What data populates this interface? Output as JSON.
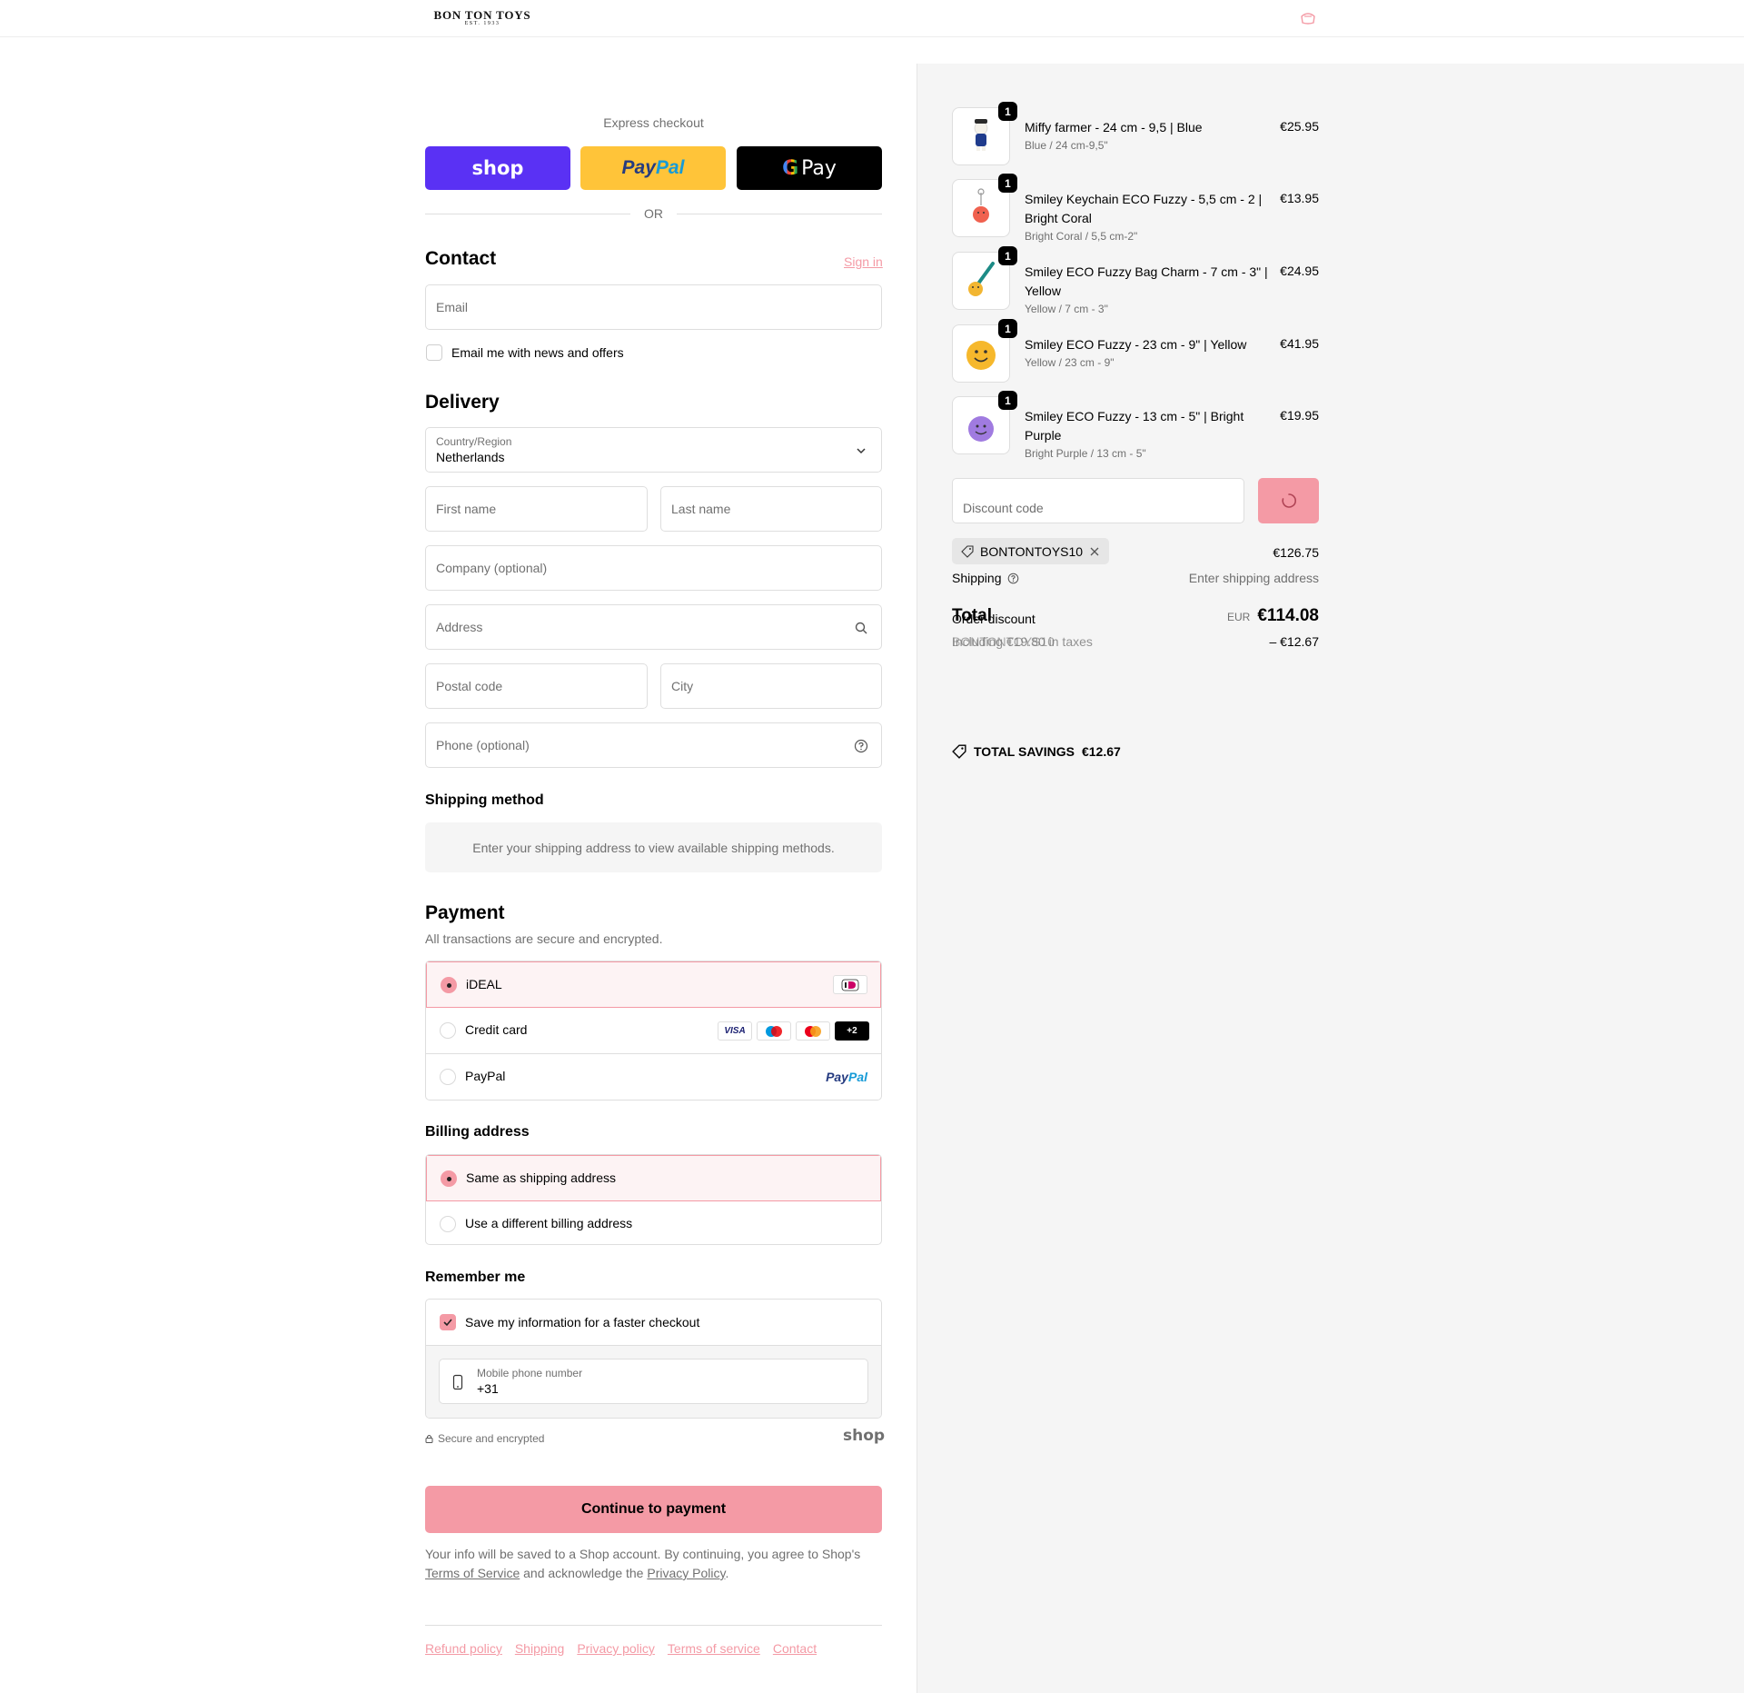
{
  "header": {
    "logo_main": "BON TON TOYS",
    "logo_sub": "EST. 1933"
  },
  "express": {
    "label": "Express checkout",
    "shop": "shop",
    "paypal_1": "Pay",
    "paypal_2": "Pal",
    "gpay_g": "G",
    "gpay": "Pay",
    "or": "OR"
  },
  "contact": {
    "title": "Contact",
    "sign_in": "Sign in",
    "email_placeholder": "Email",
    "newsletter": "Email me with news and offers"
  },
  "delivery": {
    "title": "Delivery",
    "country_label": "Country/Region",
    "country_value": "Netherlands",
    "first_name": "First name",
    "last_name": "Last name",
    "company": "Company (optional)",
    "address": "Address",
    "postal": "Postal code",
    "city": "City",
    "phone": "Phone (optional)"
  },
  "shipping_method": {
    "title": "Shipping method",
    "info": "Enter your shipping address to view available shipping methods."
  },
  "payment": {
    "title": "Payment",
    "subtitle": "All transactions are secure and encrypted.",
    "options": [
      "iDEAL",
      "Credit card",
      "PayPal"
    ],
    "selected": "iDEAL",
    "cards": {
      "visa": "VISA",
      "more": "+2"
    },
    "paypal_1": "Pay",
    "paypal_2": "Pal"
  },
  "billing": {
    "title": "Billing address",
    "options": [
      "Same as shipping address",
      "Use a different billing address"
    ],
    "selected": "Same as shipping address"
  },
  "remember": {
    "title": "Remember me",
    "save": "Save my information for a faster checkout",
    "mobile_label": "Mobile phone number",
    "mobile_value": "+31",
    "secure": "Secure and encrypted",
    "shop": "shop"
  },
  "cta": {
    "continue": "Continue to payment"
  },
  "legal": {
    "text_1": "Your info will be saved to a Shop account. By continuing, you agree to Shop's",
    "terms": "Terms of Service",
    "text_2": "and acknowledge the",
    "privacy": "Privacy Policy",
    "end": "."
  },
  "footer": {
    "links": [
      "Refund policy",
      "Shipping",
      "Privacy policy",
      "Terms of service",
      "Contact"
    ]
  },
  "summary": {
    "items": [
      {
        "qty": "1",
        "name": "Miffy farmer - 24 cm - 9,5 | Blue",
        "variant": "Blue / 24 cm-9,5\"",
        "price": "€25.95"
      },
      {
        "qty": "1",
        "name": "Smiley Keychain ECO Fuzzy - 5,5 cm - 2 | Bright Coral",
        "variant": "Bright Coral / 5,5 cm-2\"",
        "price": "€13.95"
      },
      {
        "qty": "1",
        "name": "Smiley ECO Fuzzy Bag Charm - 7 cm - 3\" | Yellow",
        "variant": "Yellow / 7 cm - 3\"",
        "price": "€24.95"
      },
      {
        "qty": "1",
        "name": "Smiley ECO Fuzzy - 23 cm - 9\" | Yellow",
        "variant": "Yellow / 23 cm - 9\"",
        "price": "€41.95"
      },
      {
        "qty": "1",
        "name": "Smiley ECO Fuzzy - 13 cm - 5\" | Bright Purple",
        "variant": "Bright Purple / 13 cm - 5\"",
        "price": "€19.95"
      }
    ],
    "discount_placeholder": "Discount code",
    "discount_tag": "BONTONTOYS10",
    "subtotal": "€126.75",
    "shipping_label": "Shipping",
    "shipping_value": "Enter shipping address",
    "total_label": "Total",
    "currency": "EUR",
    "total": "€114.08",
    "order_discount": "Order discount",
    "discount_code_line": "BONTONTOYS10",
    "including_taxes": "Including €19.80 in taxes",
    "discount_amount": "– €12.67",
    "savings_label": "TOTAL SAVINGS",
    "savings_value": "€12.67"
  },
  "colors": {
    "accent": "#f49aa5",
    "shop": "#5a31f4",
    "paypal": "#ffc439"
  }
}
